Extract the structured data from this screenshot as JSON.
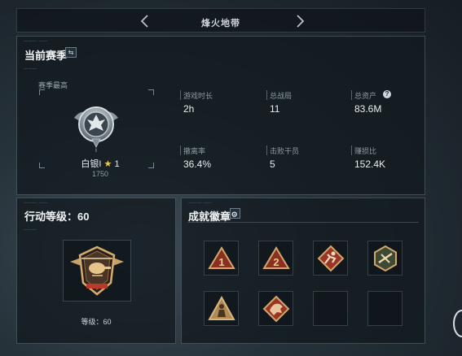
{
  "nav": {
    "title": "烽火地带"
  },
  "season": {
    "title": "当前赛季",
    "best_label": "赛季最高",
    "rank_name": "白银I",
    "rank_stars": "1",
    "rank_points": "1750",
    "stats": [
      {
        "label": "游戏时长",
        "value": "2h"
      },
      {
        "label": "总战局",
        "value": "11"
      },
      {
        "label": "总资产",
        "value": "83.6M"
      },
      {
        "label": "撤离率",
        "value": "36.4%"
      },
      {
        "label": "击败干员",
        "value": "5"
      },
      {
        "label": "赚损比",
        "value": "152.4K"
      }
    ],
    "help_icon": "?"
  },
  "action": {
    "title": "行动等级：60",
    "level_caption": "等级：60"
  },
  "achievements": {
    "title": "成就徽章",
    "badges": [
      {
        "icon": "rank-1-triangle-badge-icon"
      },
      {
        "icon": "rank-2-triangle-badge-icon"
      },
      {
        "icon": "runner-diamond-badge-icon"
      },
      {
        "icon": "rifle-hexagon-badge-icon"
      },
      {
        "icon": "soldier-triangle-badge-icon"
      },
      {
        "icon": "beast-diamond-badge-icon"
      },
      {
        "icon": "empty-slot"
      },
      {
        "icon": "empty-slot"
      }
    ]
  },
  "colors": {
    "badge_red": "#b0402e",
    "badge_gold": "#d0a66b",
    "panel_border": "#5c6a73",
    "star_gold": "#f2c84b"
  }
}
